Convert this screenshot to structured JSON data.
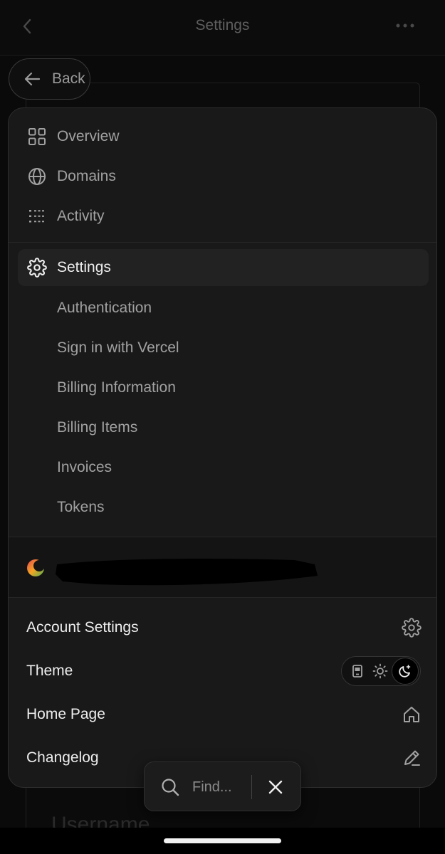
{
  "topbar": {
    "title": "Settings"
  },
  "back_pill": {
    "label": "Back"
  },
  "menu": {
    "primary": [
      {
        "label": "Overview",
        "icon": "grid-icon"
      },
      {
        "label": "Domains",
        "icon": "globe-icon"
      },
      {
        "label": "Activity",
        "icon": "list-icon"
      }
    ],
    "active": {
      "label": "Settings",
      "icon": "gear-icon"
    },
    "sub_items": [
      "Authentication",
      "Sign in with Vercel",
      "Billing Information",
      "Billing Items",
      "Invoices",
      "Tokens"
    ],
    "footer": {
      "account_settings": "Account Settings",
      "theme": "Theme",
      "home_page": "Home Page",
      "changelog": "Changelog"
    },
    "theme_selected": "dark"
  },
  "findbar": {
    "placeholder": "Find..."
  },
  "background": {
    "ghost_text": "Username"
  },
  "colors": {
    "accent_green": "#4caf50",
    "accent_red": "#e5484d",
    "accent_orange": "#f5a524"
  }
}
